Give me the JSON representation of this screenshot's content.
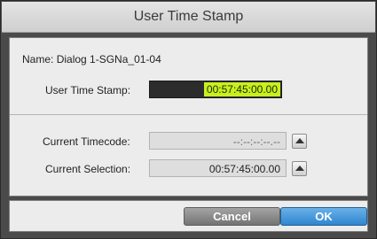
{
  "dialog": {
    "title": "User Time Stamp"
  },
  "info": {
    "name_label": "Name:",
    "name_value": "Dialog 1-SGNa_01-04"
  },
  "user_time_stamp": {
    "label": "User Time Stamp:",
    "value": "00:57:45:00.00"
  },
  "current_timecode": {
    "label": "Current Timecode:",
    "value": "--:--:--:--.--"
  },
  "current_selection": {
    "label": "Current Selection:",
    "value": "00:57:45:00.00"
  },
  "buttons": {
    "cancel": "Cancel",
    "ok": "OK"
  }
}
